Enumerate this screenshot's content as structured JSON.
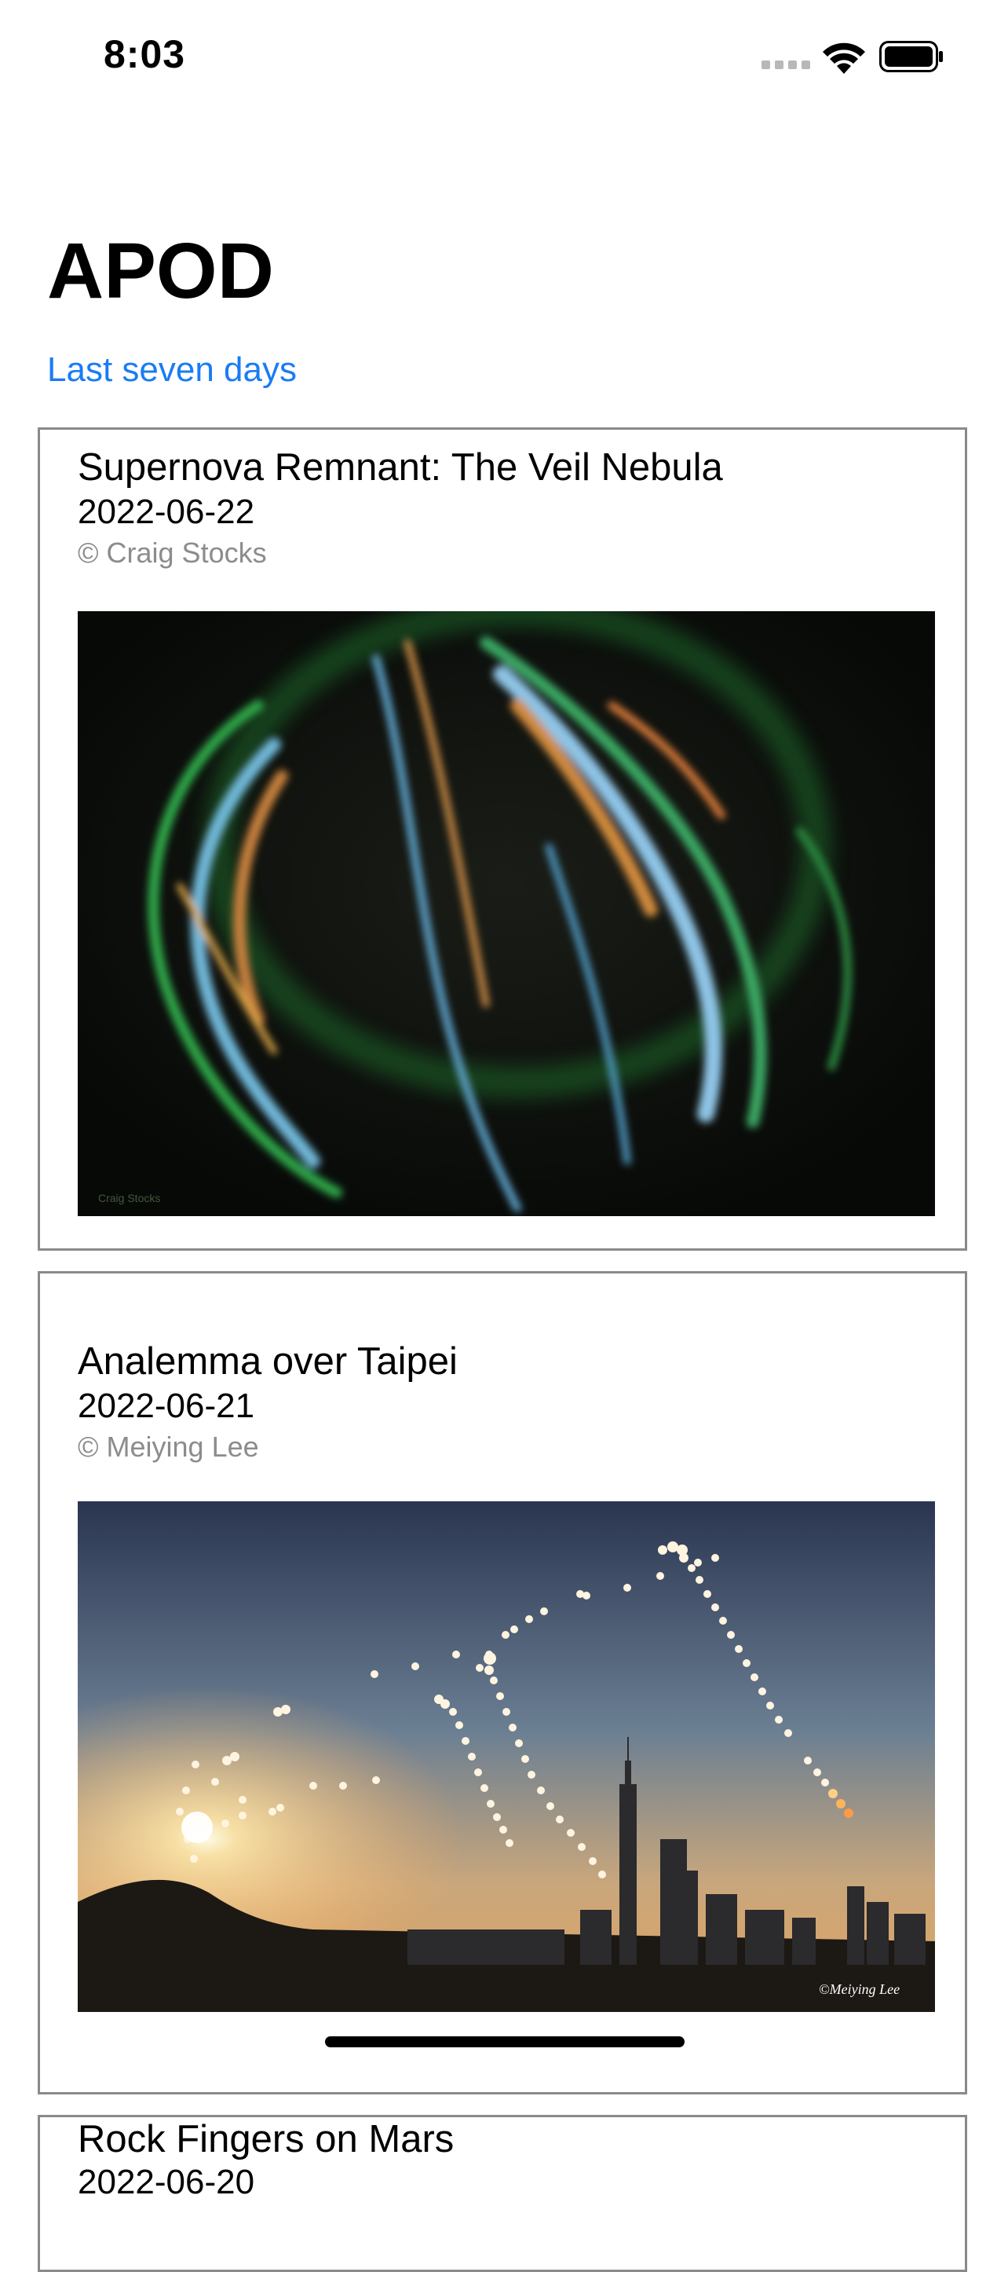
{
  "status_bar": {
    "time": "8:03",
    "icons": [
      "cellular-signal-icon",
      "wifi-icon",
      "battery-icon"
    ]
  },
  "header": {
    "title": "APOD",
    "subtitle": "Last seven days"
  },
  "entries": [
    {
      "title": "Supernova Remnant: The Veil Nebula",
      "date": "2022-06-22",
      "credit": "© Craig Stocks",
      "image_watermark": "Craig Stocks"
    },
    {
      "title": "Analemma over Taipei",
      "date": "2022-06-21",
      "credit": "© Meiying Lee",
      "image_watermark": "©Meiying Lee"
    },
    {
      "title": "Rock Fingers on Mars",
      "date": "2022-06-20"
    }
  ],
  "colors": {
    "accent": "#1a7cf4",
    "card_border": "#8a8a8a",
    "secondary_text": "#8c8c8c"
  }
}
